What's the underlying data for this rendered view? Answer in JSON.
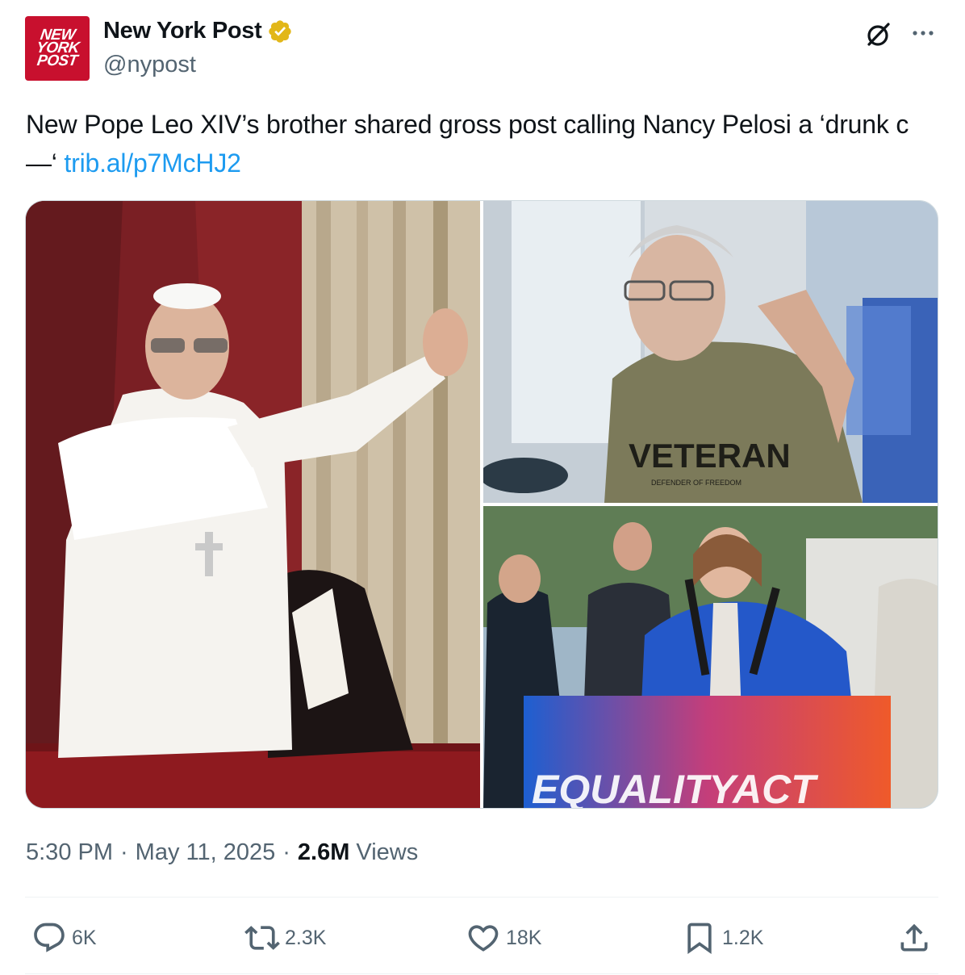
{
  "account": {
    "avatar_lines": [
      "NEW",
      "YORK",
      "POST"
    ],
    "display_name": "New York Post",
    "handle": "@nypost",
    "verified_icon": "gold-verified-badge-icon",
    "brand_color": "#c8102e"
  },
  "header_icons": {
    "grok": "grok-icon",
    "more": "more-horizontal-icon"
  },
  "tweet": {
    "text": "New Pope Leo XIV’s brother shared gross post calling Nancy Pelosi a ‘drunk c—‘",
    "link": "trib.al/p7McHJ2",
    "link_color": "#1d9bf0"
  },
  "media": {
    "photos": [
      "photo-pope-waving",
      "photo-brother-veteran",
      "photo-pelosi-podium"
    ],
    "shirt_text": "VETERAN",
    "shirt_subtext": "DEFENDER OF FREEDOM",
    "podium_text": "EQUALITYACT"
  },
  "meta": {
    "time": "5:30 PM",
    "date": "May 11, 2025",
    "views_count": "2.6M",
    "views_label": "Views"
  },
  "actions": {
    "replies": "6K",
    "reposts": "2.3K",
    "likes": "18K",
    "bookmarks": "1.2K",
    "icons": [
      "reply-icon",
      "repost-icon",
      "like-icon",
      "bookmark-icon",
      "share-icon"
    ]
  }
}
